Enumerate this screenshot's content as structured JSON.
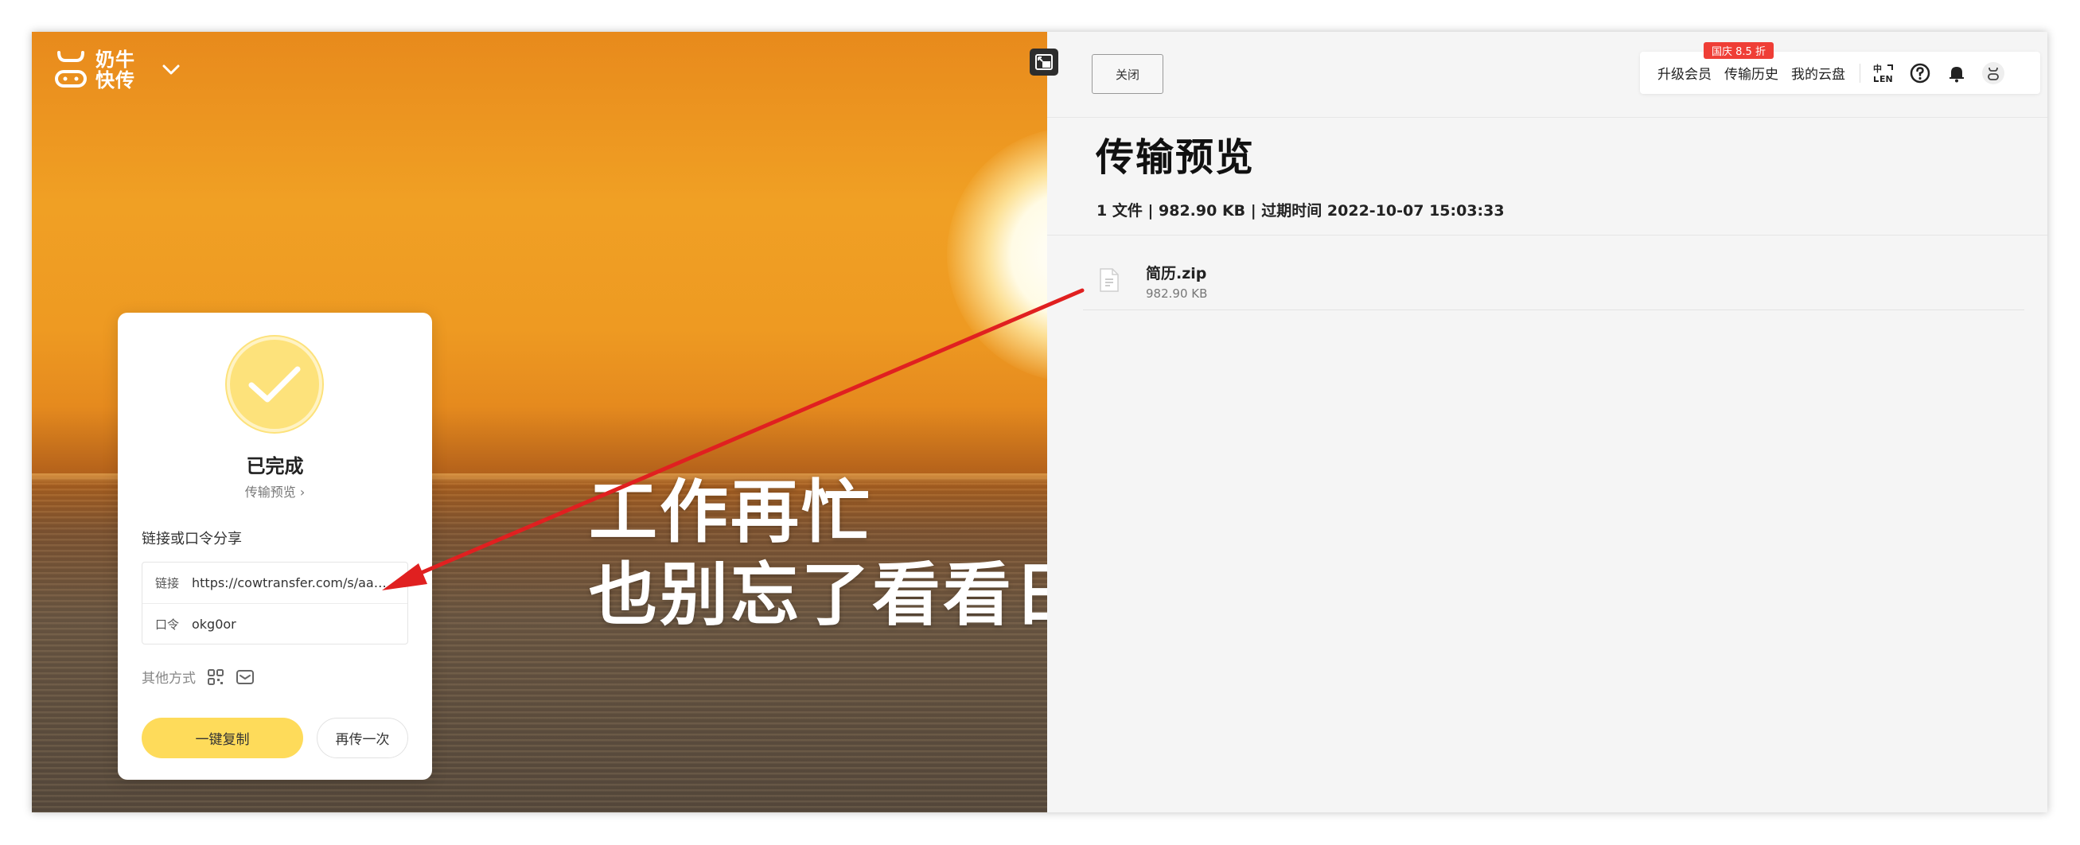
{
  "app": {
    "logo_text": "奶牛快传",
    "slogan_line1": "工作再忙",
    "slogan_line2": "也别忘了看看日"
  },
  "card": {
    "status_title": "已完成",
    "preview_link": "传输预览 ›",
    "share_label": "链接或口令分享",
    "link_key": "链接",
    "link_value": "https://cowtransfer.com/s/aa70...",
    "code_key": "口令",
    "code_value": "okg0or",
    "other_ways": "其他方式",
    "copy_button": "一键复制",
    "retry_button": "再传一次",
    "accent_color": "#fedb5a"
  },
  "panel": {
    "close_button": "关闭",
    "nav": {
      "promo_badge": "国庆 8.5 折",
      "upgrade": "升级会员",
      "history": "传输历史",
      "cloud": "我的云盘",
      "icons": [
        "language-icon",
        "help-icon",
        "bell-icon",
        "avatar"
      ]
    },
    "title": "传输预览",
    "meta": "1 文件 | 982.90 KB | 过期时间 2022-10-07 15:03:33",
    "files": [
      {
        "name": "简历.zip",
        "size": "982.90 KB"
      }
    ]
  }
}
